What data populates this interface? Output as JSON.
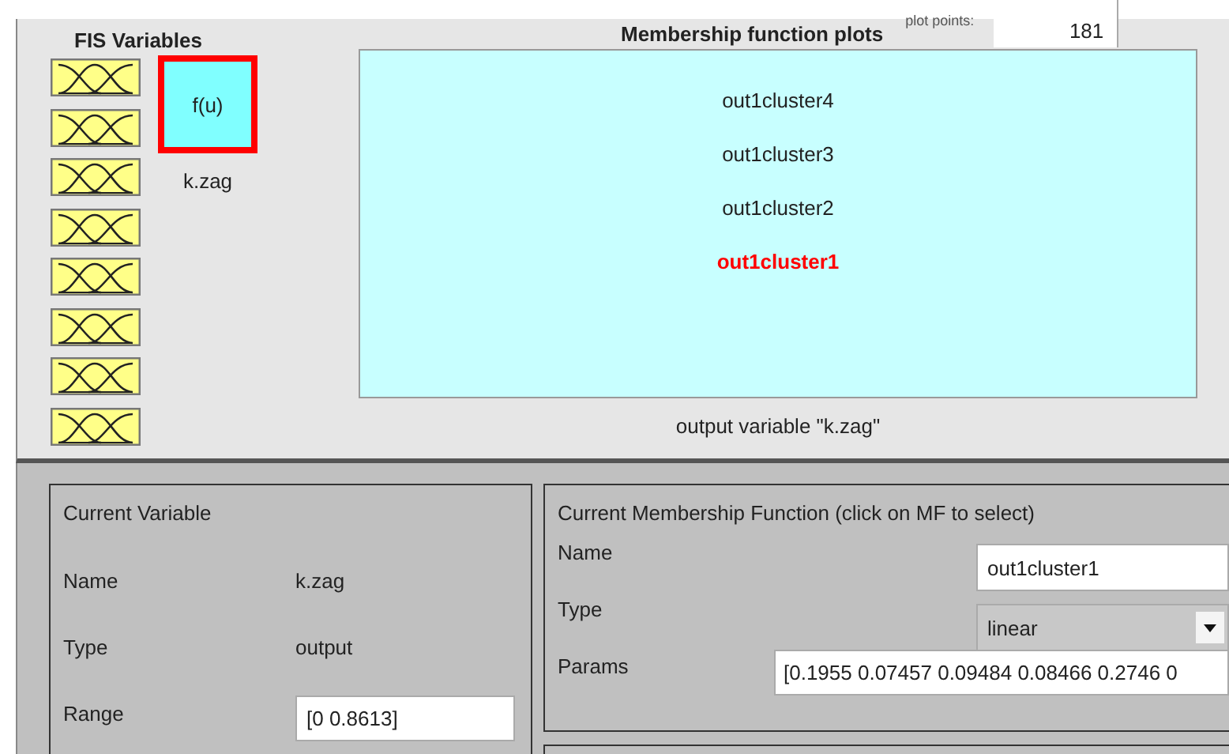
{
  "fis_variables": {
    "title": "FIS Variables",
    "inputs": [
      {
        "selected": false
      },
      {
        "selected": false
      },
      {
        "selected": false
      },
      {
        "selected": false
      },
      {
        "selected": false
      },
      {
        "selected": false
      },
      {
        "selected": false
      },
      {
        "selected": false
      }
    ],
    "output": {
      "label": "f(u)",
      "name": "k.zag",
      "selected": true
    }
  },
  "plots": {
    "title": "Membership function plots",
    "plot_points_label": "plot points:",
    "plot_points": "181",
    "mfs": [
      {
        "label": "out1cluster4",
        "selected": false
      },
      {
        "label": "out1cluster3",
        "selected": false
      },
      {
        "label": "out1cluster2",
        "selected": false
      },
      {
        "label": "out1cluster1",
        "selected": true
      }
    ],
    "caption": "output variable \"k.zag\""
  },
  "current_variable": {
    "title": "Current Variable",
    "rows": [
      {
        "label": "Name",
        "value": "k.zag",
        "kind": "text"
      },
      {
        "label": "Type",
        "value": "output",
        "kind": "text"
      },
      {
        "label": "Range",
        "value": "[0 0.8613]",
        "kind": "field"
      }
    ]
  },
  "current_mf": {
    "title": "Current Membership Function (click on MF to select)",
    "rows": [
      {
        "label": "Name",
        "value": "out1cluster1",
        "kind": "field"
      },
      {
        "label": "Type",
        "value": "linear",
        "kind": "dropdown"
      },
      {
        "label": "Params",
        "value": "[0.1955 0.07457 0.09484 0.08466 0.2746 0",
        "kind": "wide"
      }
    ]
  }
}
